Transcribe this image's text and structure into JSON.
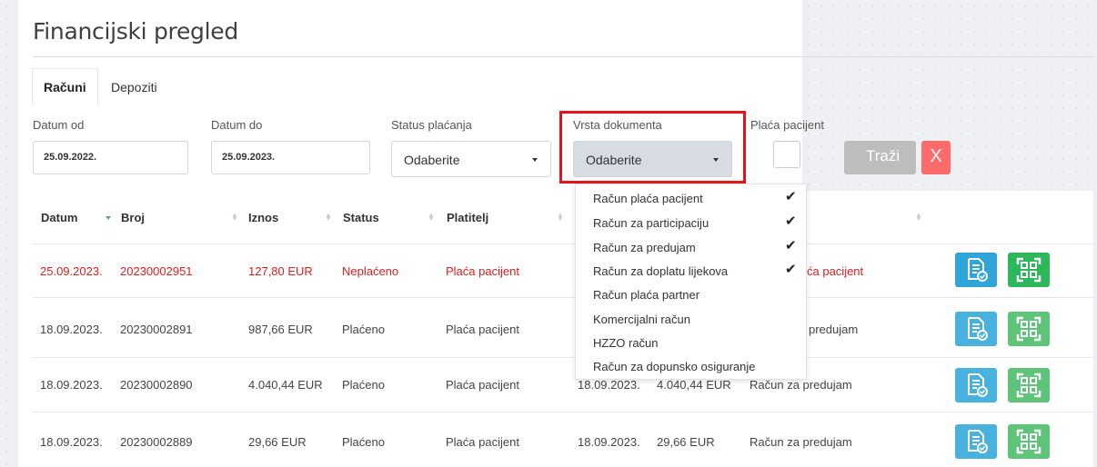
{
  "page": {
    "title": "Financijski pregled"
  },
  "tabs": [
    "Računi",
    "Depoziti"
  ],
  "filters": {
    "date_from_label": "Datum od",
    "date_from_value": "25.09.2022.",
    "date_to_label": "Datum do",
    "date_to_value": "25.09.2023.",
    "payment_status_label": "Status plaćanja",
    "payment_status_value": "Odaberite",
    "doc_type_label": "Vrsta dokumenta",
    "doc_type_value": "Odaberite",
    "patient_pays_label": "Plaća pacijent",
    "search_label": "Traži",
    "clear_label": "X"
  },
  "doc_type_options": [
    {
      "label": "Račun plaća pacijent",
      "checked": true
    },
    {
      "label": "Račun za participaciju",
      "checked": true
    },
    {
      "label": "Račun za predujam",
      "checked": true
    },
    {
      "label": "Račun za doplatu lijekova",
      "checked": true
    },
    {
      "label": "Račun plaća partner",
      "checked": false
    },
    {
      "label": "Komercijalni račun",
      "checked": false
    },
    {
      "label": "HZZO račun",
      "checked": false
    },
    {
      "label": "Račun za dopunsko osiguranje",
      "checked": false
    }
  ],
  "table": {
    "headers": {
      "date": "Datum",
      "number": "Broj",
      "amount": "Iznos",
      "status": "Status",
      "payer": "Platitelj"
    },
    "rows": [
      {
        "date": "25.09.2023.",
        "number": "20230002951",
        "amount": "127,80 EUR",
        "status": "Neplaćeno",
        "payer": "Plaća pacijent",
        "date2": "",
        "amount2": "",
        "type": "ća pacijent",
        "highlight": true
      },
      {
        "date": "18.09.2023.",
        "number": "20230002891",
        "amount": "987,66 EUR",
        "status": "Plaćeno",
        "payer": "Plaća pacijent",
        "date2": "",
        "amount2": "",
        "type": "predujam",
        "highlight": false
      },
      {
        "date": "18.09.2023.",
        "number": "20230002890",
        "amount": "4.040,44 EUR",
        "status": "Plaćeno",
        "payer": "Plaća pacijent",
        "date2": "18.09.2023.",
        "amount2": "4.040,44 EUR",
        "type": "Račun za predujam",
        "highlight": false
      },
      {
        "date": "18.09.2023.",
        "number": "20230002889",
        "amount": "29,66 EUR",
        "status": "Plaćeno",
        "payer": "Plaća pacijent",
        "date2": "18.09.2023.",
        "amount2": "29,66 EUR",
        "type": "Račun za predujam",
        "highlight": false
      }
    ]
  },
  "colors": {
    "accent_red": "#e21d1d",
    "btn_blue": "#2ea4d7",
    "btn_green": "#2cb85a"
  }
}
